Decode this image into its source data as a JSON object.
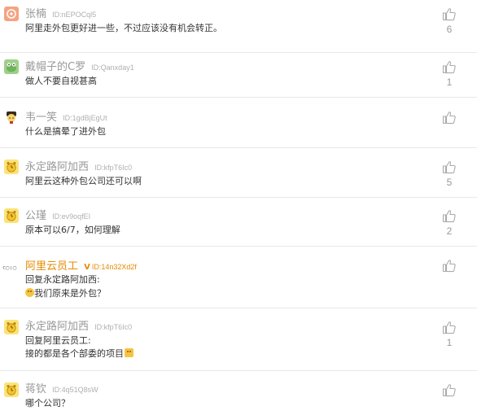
{
  "comments": [
    {
      "name": "张楠",
      "uid": "ID:nEPOCql5",
      "text": "阿里走外包更好进一些，不过应该没有机会转正。",
      "likes": "6",
      "avatar": "orange-circle-avatar-icon"
    },
    {
      "name": "戴帽子的C罗",
      "uid": "ID:Qanxday1",
      "text": "做人不要自视甚高",
      "likes": "1",
      "avatar": "green-frog-avatar-icon"
    },
    {
      "name": "韦一笑",
      "uid": "ID:1gdBjEgUt",
      "text": "什么是搞晕了进外包",
      "likes": "",
      "avatar": "yellow-face-avatar-icon"
    },
    {
      "name": "永定路阿加西",
      "uid": "ID:kfpT6Ic0",
      "text": "阿里云这种外包公司还可以啊",
      "likes": "5",
      "avatar": "yellow-alarm-avatar-icon"
    },
    {
      "name": "公瑾",
      "uid": "ID:ev9oqfEI",
      "text": "原本可以6/7，如何理解",
      "likes": "2",
      "avatar": "yellow-alarm-avatar-icon"
    },
    {
      "name": "阿里云员工",
      "badge": "V",
      "uid": "ID:14n32Xd2f",
      "text_line1": "回复永定路阿加西:",
      "text_line2": "我们原来是外包？",
      "likes": "",
      "avatar": "company-logo-avatar-icon"
    },
    {
      "name": "永定路阿加西",
      "uid": "ID:kfpT6Ic0",
      "text_line1": "回复阿里云员工:",
      "text_line2": "接的都是各个部委的项目",
      "likes": "1",
      "avatar": "yellow-alarm-avatar-icon"
    },
    {
      "name": "蒋钦",
      "uid": "ID:4q51Q8sW",
      "text": "哪个公司？",
      "likes": "",
      "avatar": "yellow-alarm-avatar-icon"
    }
  ],
  "company_logo_text": "C◯❘◯"
}
